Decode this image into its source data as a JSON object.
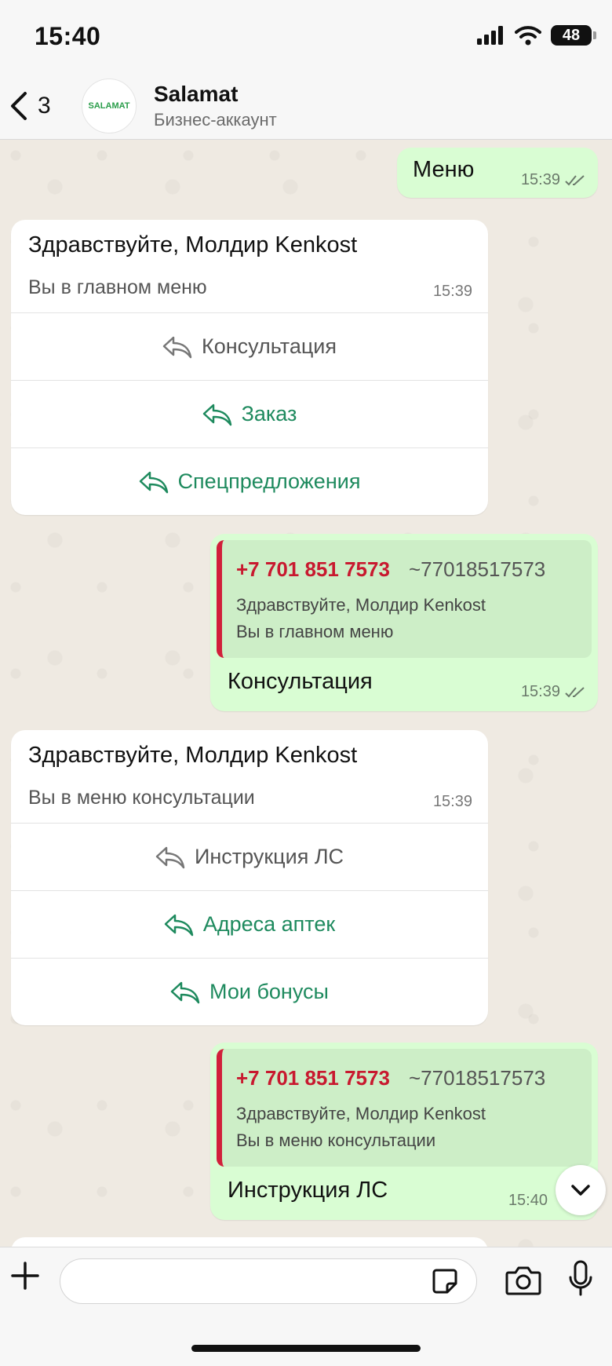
{
  "status_bar": {
    "time": "15:40",
    "battery": "48"
  },
  "header": {
    "back_count": "3",
    "avatar_text": "SALAMAT",
    "contact_name": "Salamat",
    "contact_subtitle": "Бизнес-аккаунт"
  },
  "messages": {
    "m1": {
      "text": "Меню",
      "time": "15:39"
    },
    "m2": {
      "title": "Здравствуйте, Молдир Kenkost",
      "subtitle": "Вы в главном меню",
      "time": "15:39",
      "buttons": [
        "Консультация",
        "Заказ",
        "Спецпредложения"
      ]
    },
    "m3": {
      "quote_phone": "+7 701 851 7573",
      "quote_alias": "~77018517573",
      "quote_line1": "Здравствуйте, Молдир Kenkost",
      "quote_line2": "Вы в главном меню",
      "text": "Консультация",
      "time": "15:39"
    },
    "m4": {
      "title": "Здравствуйте, Молдир Kenkost",
      "subtitle": "Вы в меню консультации",
      "time": "15:39",
      "buttons": [
        "Инструкция ЛС",
        "Адреса аптек",
        "Мои бонусы"
      ]
    },
    "m5": {
      "quote_phone": "+7 701 851 7573",
      "quote_alias": "~77018517573",
      "quote_line1": "Здравствуйте, Молдир Kenkost",
      "quote_line2": "Вы в меню консультации",
      "text": "Инструкция ЛС",
      "time": "15:40"
    }
  },
  "input": {
    "value": "",
    "placeholder": ""
  },
  "colors": {
    "bubble_out": "#d9fdd3",
    "quote_bar": "#d1203b",
    "button_green": "#1e8a5e"
  }
}
